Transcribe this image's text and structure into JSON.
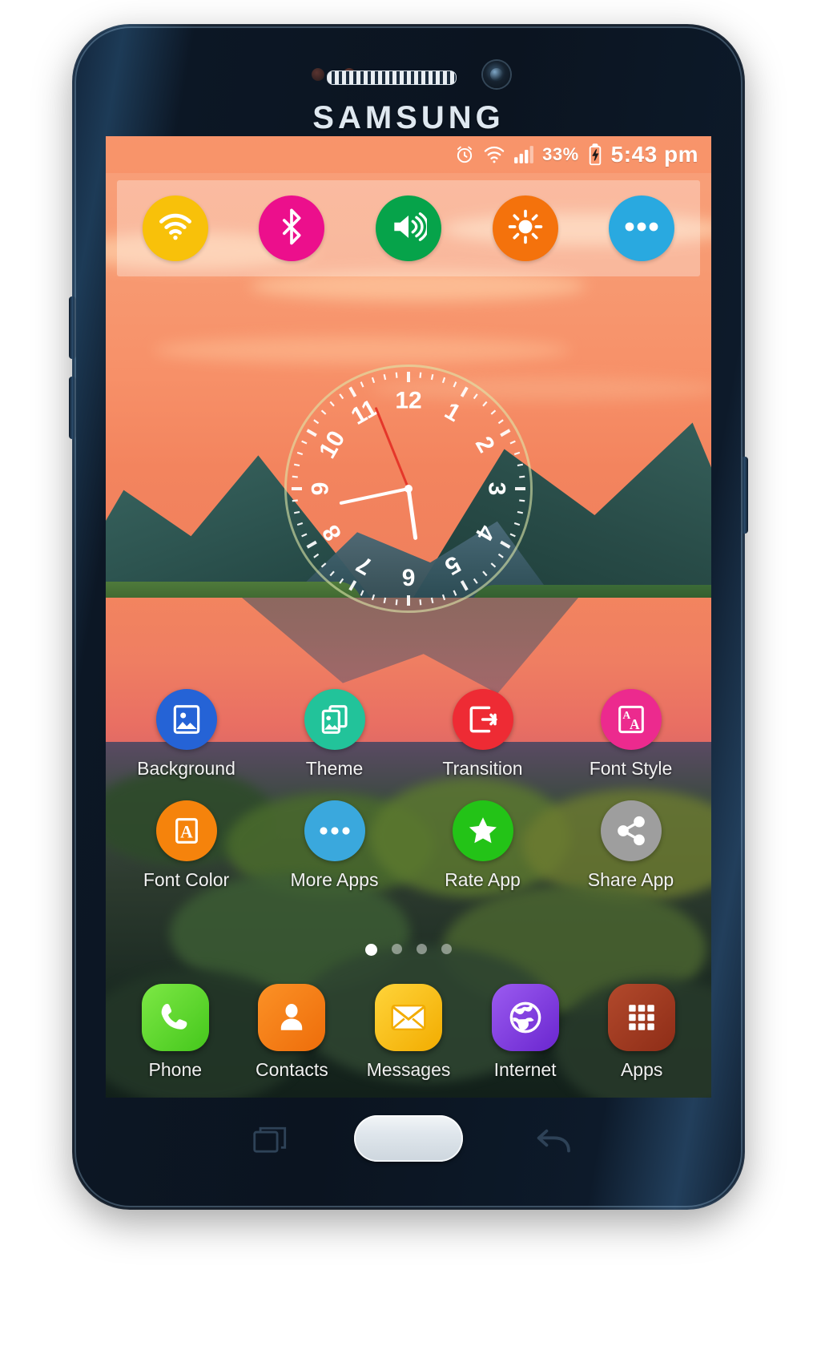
{
  "device": {
    "brand_logo": "SAMSUNG",
    "hardware": {
      "earpiece": "earpiece-speaker",
      "front_camera": "front-camera",
      "proximity_sensor": "proximity-sensor",
      "light_sensor": "light-sensor",
      "home_button": "home-button",
      "recents_key": "recents-key",
      "back_key": "back-key",
      "volume_up": "volume-up-button",
      "volume_down": "volume-down-button",
      "power": "power-button"
    }
  },
  "statusbar": {
    "alarm_icon": "alarm-icon",
    "wifi_icon": "wifi-icon",
    "signal_icon": "signal-bars-icon",
    "battery_percent": "33%",
    "battery_icon": "battery-charging-icon",
    "time": "5:43 pm",
    "background_color": "#f79269",
    "text_color": "#ffffff"
  },
  "quick_settings": {
    "panel_background": "rgba(255,255,255,0.30)",
    "toggles": [
      {
        "name": "wifi",
        "label": "Wi-Fi",
        "icon": "wifi-icon",
        "color": "#f8c10a"
      },
      {
        "name": "bluetooth",
        "label": "Bluetooth",
        "icon": "bluetooth-icon",
        "color": "#ec0f8c"
      },
      {
        "name": "sound",
        "label": "Sound",
        "icon": "volume-icon",
        "color": "#06a34a"
      },
      {
        "name": "brightness",
        "label": "Brightness",
        "icon": "brightness-sun-icon",
        "color": "#f4720c"
      },
      {
        "name": "more",
        "label": "More",
        "icon": "more-dots-icon",
        "color": "#29a9e0"
      }
    ]
  },
  "clock_widget": {
    "type": "analog",
    "numerals": [
      "12",
      "1",
      "2",
      "3",
      "4",
      "5",
      "6",
      "7",
      "8",
      "9",
      "10",
      "11"
    ],
    "hour_hand_angle": 172,
    "minute_hand_angle": 258,
    "second_hand_angle": 338,
    "hand_color": "#ffffff",
    "second_hand_color": "#e5372a",
    "ring_color": "rgba(222,232,170,0.60)"
  },
  "app_grid": {
    "rows": [
      [
        {
          "label": "Background",
          "icon": "image-picture-icon",
          "color": "#2563d6"
        },
        {
          "label": "Theme",
          "icon": "images-stack-icon",
          "color": "#22c39a"
        },
        {
          "label": "Transition",
          "icon": "transition-arrow-icon",
          "color": "#ee2b34"
        },
        {
          "label": "Font Style",
          "icon": "font-style-aa-icon",
          "color": "#ec2a8e"
        }
      ],
      [
        {
          "label": "Font Color",
          "icon": "font-color-a-icon",
          "color": "#f5830c"
        },
        {
          "label": "More Apps",
          "icon": "more-dots-icon",
          "color": "#3aa8dd"
        },
        {
          "label": "Rate App",
          "icon": "star-icon",
          "color": "#23c317"
        },
        {
          "label": "Share App",
          "icon": "share-nodes-icon",
          "color": "#9e9e9e"
        }
      ]
    ]
  },
  "page_indicator": {
    "total": 4,
    "active_index": 0
  },
  "dock": {
    "items": [
      {
        "label": "Phone",
        "icon": "phone-handset-icon",
        "color": "#5fd92e"
      },
      {
        "label": "Contacts",
        "icon": "contact-person-icon",
        "color": "#f47b15"
      },
      {
        "label": "Messages",
        "icon": "envelope-icon",
        "color": "#f9c010"
      },
      {
        "label": "Internet",
        "icon": "globe-icon",
        "color": "#7b3ddd"
      },
      {
        "label": "Apps",
        "icon": "apps-grid-icon",
        "color": "#a33a22"
      }
    ]
  },
  "wallpaper": {
    "description": "sunset-lake-mountains",
    "sky_color": "#f79068",
    "water_color": "#ee7d60",
    "rock_color": "#2c3a2e"
  }
}
